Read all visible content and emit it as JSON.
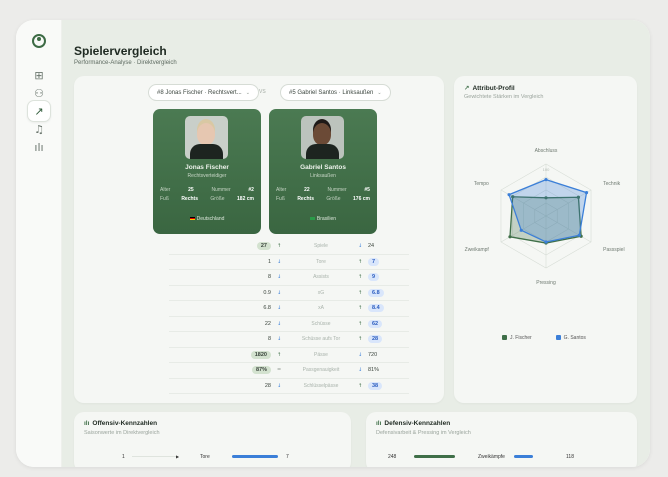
{
  "app": {
    "title": "Spielervergleich",
    "subtitle": "Performance-Analyse · Direktvergleich",
    "colors": {
      "green": "#3f6f48",
      "blue": "#3b7fd8",
      "bg": "#e8ede6"
    }
  },
  "sidebar": {
    "items": [
      {
        "icon": "dashboard-icon",
        "glyph": "⊞"
      },
      {
        "icon": "users-icon",
        "glyph": "⚇"
      },
      {
        "icon": "trend-icon",
        "glyph": "↗",
        "active": true
      },
      {
        "icon": "bell-icon",
        "glyph": "♫"
      },
      {
        "icon": "chart-icon",
        "glyph": "ılı"
      }
    ]
  },
  "comparison": {
    "select_left": "#8 Jonas Fischer · Rechtsvert...",
    "select_right": "#5 Gabriel Santos · Linksaußen",
    "vs": "VS",
    "players": [
      {
        "name": "Jonas Fischer",
        "position": "Rechtsverteidiger",
        "alter_label": "Alter",
        "alter": "25",
        "nummer_label": "Nummer",
        "nummer": "#2",
        "fuss_label": "Fuß",
        "fuss": "Rechts",
        "groesse_label": "Größe",
        "groesse": "182 cm",
        "nation": "Deutschland"
      },
      {
        "name": "Gabriel Santos",
        "position": "Linksaußen",
        "alter_label": "Alter",
        "alter": "22",
        "nummer_label": "Nummer",
        "nummer": "#5",
        "fuss_label": "Fuß",
        "fuss": "Rechts",
        "groesse_label": "Größe",
        "groesse": "176 cm",
        "nation": "Brasilien"
      }
    ],
    "stats": [
      {
        "label": "Spiele",
        "left": "27",
        "left_arrow": "↑",
        "left_win": true,
        "right": "24",
        "right_arrow": "↓",
        "right_win": false
      },
      {
        "label": "Tore",
        "left": "1",
        "left_arrow": "↓",
        "left_win": false,
        "right": "7",
        "right_arrow": "↑",
        "right_win": true
      },
      {
        "label": "Assists",
        "left": "8",
        "left_arrow": "↓",
        "left_win": false,
        "right": "9",
        "right_arrow": "↑",
        "right_win": true
      },
      {
        "label": "xG",
        "left": "0.9",
        "left_arrow": "↓",
        "left_win": false,
        "right": "6.8",
        "right_arrow": "↑",
        "right_win": true
      },
      {
        "label": "xA",
        "left": "6.8",
        "left_arrow": "↓",
        "left_win": false,
        "right": "8.4",
        "right_arrow": "↑",
        "right_win": true
      },
      {
        "label": "Schüsse",
        "left": "22",
        "left_arrow": "↓",
        "left_win": false,
        "right": "62",
        "right_arrow": "↑",
        "right_win": true
      },
      {
        "label": "Schüsse aufs Tor",
        "left": "8",
        "left_arrow": "↓",
        "left_win": false,
        "right": "28",
        "right_arrow": "↑",
        "right_win": true
      },
      {
        "label": "Pässe",
        "left": "1820",
        "left_arrow": "↑",
        "left_win": true,
        "right": "720",
        "right_arrow": "↓",
        "right_win": false
      },
      {
        "label": "Passgenauigkeit",
        "left": "87%",
        "left_arrow": "=",
        "left_win": true,
        "right": "81%",
        "right_arrow": "↓",
        "right_win": false
      },
      {
        "label": "Schlüsselpässe",
        "left": "28",
        "left_arrow": "↓",
        "left_win": false,
        "right": "38",
        "right_arrow": "↑",
        "right_win": true
      }
    ]
  },
  "radar": {
    "title": "Attribut-Profil",
    "subtitle": "Gewichtete Stärken im Vergleich",
    "axes": [
      "Abschluss",
      "Technik",
      "Passspiel",
      "Pressing",
      "Zweikampf",
      "Tempo"
    ],
    "ring_label": "100",
    "legend": [
      "J. Fischer",
      "G. Santos"
    ]
  },
  "chart_data": {
    "type": "radar",
    "categories": [
      "Abschluss",
      "Technik",
      "Passspiel",
      "Pressing",
      "Zweikampf",
      "Tempo"
    ],
    "rmax": 100,
    "series": [
      {
        "name": "J. Fischer",
        "color": "#3f6f48",
        "values": [
          35,
          72,
          78,
          52,
          80,
          74
        ]
      },
      {
        "name": "G. Santos",
        "color": "#3b7fd8",
        "values": [
          70,
          90,
          74,
          50,
          55,
          82
        ]
      }
    ]
  },
  "offensive": {
    "title": "Offensiv-Kennzahlen",
    "subtitle": "Saisonwerte im Direktvergleich",
    "row_label": "Tore",
    "left": "1",
    "right": "7",
    "left_share": 0.125,
    "right_share": 0.875
  },
  "defensive": {
    "title": "Defensiv-Kennzahlen",
    "subtitle": "Defensivarbeit & Pressing im Vergleich",
    "row_label": "Zweikämpfe",
    "left": "248",
    "right": "118",
    "left_share": 0.68,
    "right_share": 0.32
  }
}
